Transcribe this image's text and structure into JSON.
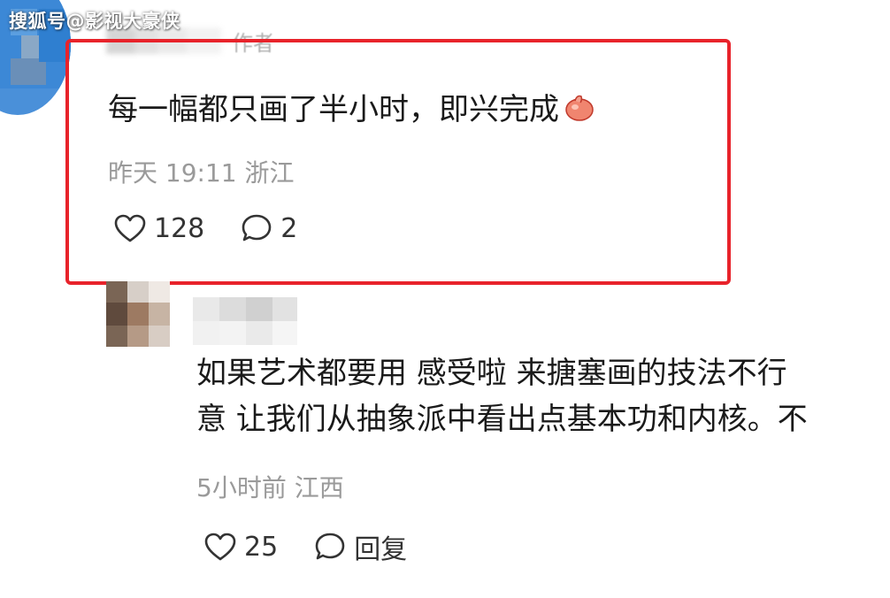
{
  "watermark": "搜狐号@影视大豪侠",
  "colors": {
    "highlight": "#e8232b",
    "meta_text": "#9a9a9a",
    "body_text": "#1a1a1a"
  },
  "comment1": {
    "author_tag": "作者",
    "text": "每一幅都只画了半小时，即兴完成",
    "emoji": "thumbs-up-emoji",
    "time": "昨天 19:11",
    "location": "浙江",
    "likes": "128",
    "replies": "2"
  },
  "comment2": {
    "text_line1": "如果艺术都要用 感受啦 来搪塞画的技法不行 ",
    "text_line2": "意 让我们从抽象派中看出点基本功和内核。不",
    "time": "5小时前",
    "location": "江西",
    "likes": "25",
    "reply_label": "回复"
  }
}
